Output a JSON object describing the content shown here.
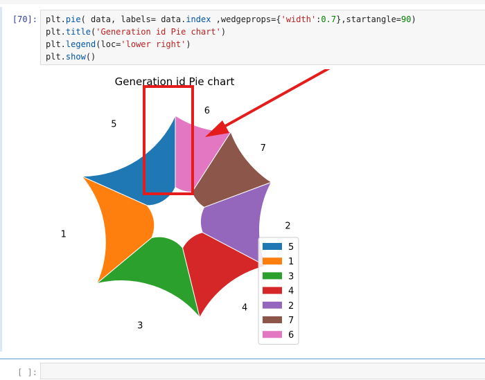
{
  "cell": {
    "prompt": "[70]:",
    "code_lines": [
      [
        {
          "t": "plt.",
          "c": ""
        },
        {
          "t": "pie",
          "c": "tk-fn"
        },
        {
          "t": "( data, labels= data.",
          "c": ""
        },
        {
          "t": "index",
          "c": "tk-fn"
        },
        {
          "t": " ,wedgeprops={",
          "c": ""
        },
        {
          "t": "'width'",
          "c": "tk-str"
        },
        {
          "t": ":",
          "c": ""
        },
        {
          "t": "0.7",
          "c": "tk-num"
        },
        {
          "t": "},startangle=",
          "c": ""
        },
        {
          "t": "90",
          "c": "tk-num"
        },
        {
          "t": ")",
          "c": ""
        }
      ],
      [
        {
          "t": "plt.",
          "c": ""
        },
        {
          "t": "title",
          "c": "tk-fn"
        },
        {
          "t": "(",
          "c": ""
        },
        {
          "t": "'Generation id Pie chart'",
          "c": "tk-str"
        },
        {
          "t": ")",
          "c": ""
        }
      ],
      [
        {
          "t": "plt.",
          "c": ""
        },
        {
          "t": "legend",
          "c": "tk-fn"
        },
        {
          "t": "(loc=",
          "c": ""
        },
        {
          "t": "'lower right'",
          "c": "tk-str"
        },
        {
          "t": ")",
          "c": ""
        }
      ],
      [
        {
          "t": "plt.",
          "c": ""
        },
        {
          "t": "show",
          "c": "tk-fn"
        },
        {
          "t": "()",
          "c": ""
        }
      ]
    ]
  },
  "next_cell": {
    "prompt": "[ ]:"
  },
  "colors": {
    "annotation": "#e41c1c",
    "series": {
      "5": "#1f77b4",
      "1": "#ff7f0e",
      "3": "#2ca02c",
      "4": "#d62728",
      "2": "#9467bd",
      "7": "#8c564b",
      "6": "#e377c2"
    }
  },
  "chart_data": {
    "type": "pie",
    "title": "Generation id Pie chart",
    "categories": [
      "5",
      "1",
      "3",
      "4",
      "2",
      "7",
      "6"
    ],
    "values": [
      165,
      160,
      160,
      121,
      121,
      92,
      82
    ],
    "startangle": 90,
    "wedge_width": 0.7,
    "legend": {
      "location": "lower right",
      "entries": [
        "5",
        "1",
        "3",
        "4",
        "2",
        "7",
        "6"
      ]
    }
  }
}
